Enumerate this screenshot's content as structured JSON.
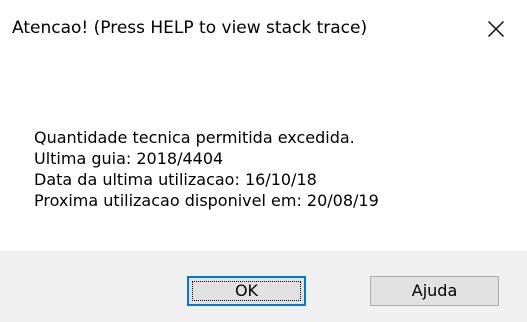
{
  "dialog": {
    "title": "Atencao! (Press HELP to view stack trace)",
    "close_icon": "close-icon",
    "message_lines": [
      "Quantidade tecnica permitida excedida.",
      "Ultima guia: 2018/4404",
      "Data da ultima utilizacao: 16/10/18",
      "Proxima utilizacao disponivel em: 20/08/19"
    ],
    "buttons": {
      "ok_label": "OK",
      "help_label": "Ajuda"
    }
  },
  "colors": {
    "background": "#ffffff",
    "footer": "#f0f0f0",
    "button_face": "#e1e1e1",
    "button_border": "#adadad",
    "focus_border": "#0078d7",
    "text": "#000000"
  }
}
